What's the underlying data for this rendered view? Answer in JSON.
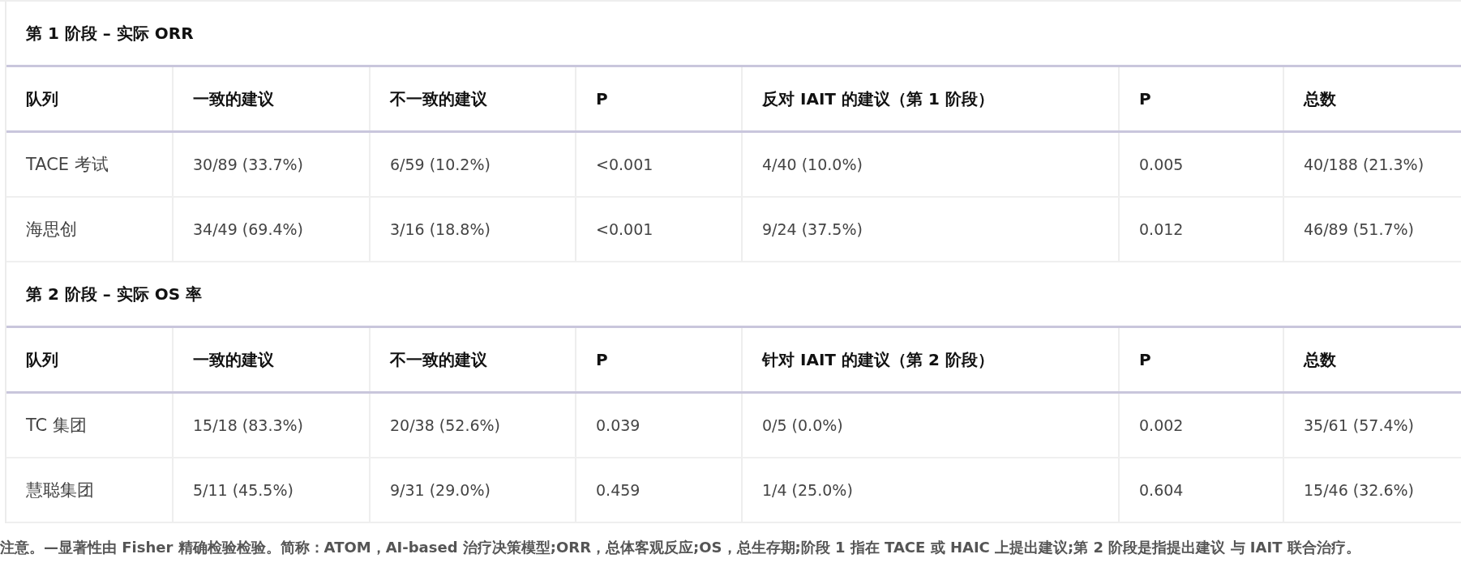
{
  "sections": [
    {
      "title": "第 1 阶段 – 实际 ORR",
      "columns": [
        "队列",
        "一致的建议",
        "不一致的建议",
        "P",
        "反对 IAIT 的建议（第 1 阶段）",
        "P",
        "总数"
      ],
      "rows": [
        [
          "TACE 考试",
          "30/89 (33.7%)",
          "6/59 (10.2%)",
          "<0.001",
          "4/40 (10.0%)",
          "0.005",
          "40/188 (21.3%)"
        ],
        [
          "海思创",
          "34/49 (69.4%)",
          "3/16 (18.8%)",
          "<0.001",
          "9/24 (37.5%)",
          "0.012",
          "46/89 (51.7%)"
        ]
      ]
    },
    {
      "title": "第 2 阶段 – 实际 OS 率",
      "columns": [
        "队列",
        "一致的建议",
        "不一致的建议",
        "P",
        "针对 IAIT 的建议（第 2 阶段）",
        "P",
        "总数"
      ],
      "rows": [
        [
          "TC 集团",
          "15/18 (83.3%)",
          "20/38 (52.6%)",
          "0.039",
          "0/5 (0.0%)",
          "0.002",
          "35/61 (57.4%)"
        ],
        [
          "慧聪集团",
          "5/11 (45.5%)",
          "9/31 (29.0%)",
          "0.459",
          "1/4 (25.0%)",
          "0.604",
          "15/46 (32.6%)"
        ]
      ]
    }
  ],
  "note": "注意。—显著性由 Fisher 精确检验检验。简称：ATOM，AI-based 治疗决策模型;ORR，总体客观反应;OS，总生存期;阶段 1 指在 TACE 或 HAIC 上提出建议;第 2 阶段是指提出建议 与 IAIT 联合治疗。"
}
